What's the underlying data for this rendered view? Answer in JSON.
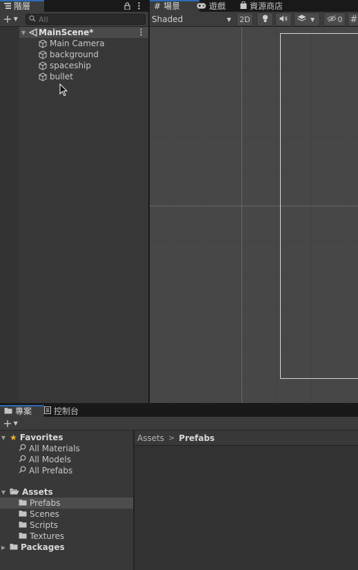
{
  "hierarchy": {
    "tab_label": "階層",
    "search_placeholder": "All",
    "scene_name": "MainScene*",
    "items": [
      {
        "label": "Main Camera"
      },
      {
        "label": "background"
      },
      {
        "label": "spaceship"
      },
      {
        "label": "bullet"
      }
    ]
  },
  "scene_view": {
    "tabs": [
      {
        "label": "場景"
      },
      {
        "label": "遊戲"
      },
      {
        "label": "資源商店"
      }
    ],
    "shading_mode": "Shaded",
    "toggle_2d": "2D",
    "hidden_count": "0",
    "colors": {
      "background": "#474747",
      "grid": "#434343",
      "axis": "#686868"
    }
  },
  "project": {
    "tabs": [
      {
        "label": "專案"
      },
      {
        "label": "控制台"
      }
    ],
    "favorites": {
      "label": "Favorites",
      "items": [
        {
          "label": "All Materials"
        },
        {
          "label": "All Models"
        },
        {
          "label": "All Prefabs"
        }
      ]
    },
    "assets": {
      "label": "Assets",
      "items": [
        {
          "label": "Prefabs"
        },
        {
          "label": "Scenes"
        },
        {
          "label": "Scripts"
        },
        {
          "label": "Textures"
        }
      ]
    },
    "packages_label": "Packages",
    "breadcrumb": {
      "root": "Assets",
      "current": "Prefabs"
    }
  }
}
